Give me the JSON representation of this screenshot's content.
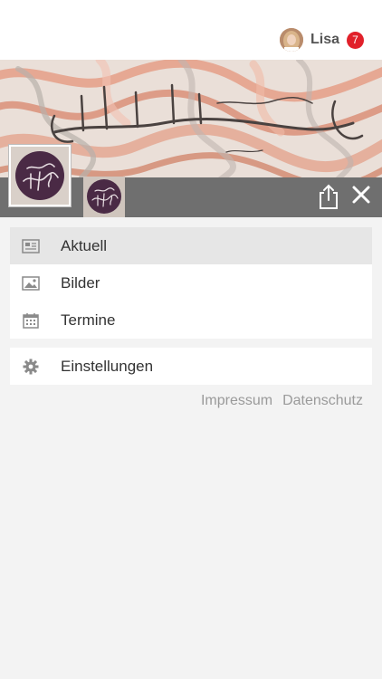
{
  "header": {
    "user_name": "Lisa",
    "notification_count": "7",
    "badge_color": "#e1202a",
    "avatar_icon": "user-avatar"
  },
  "banner": {
    "background_icon": "marbled-calligraphy-banner",
    "logo_large_icon": "calligraphy-logo",
    "logo_small_icon": "calligraphy-logo"
  },
  "toolbar": {
    "share_icon": "share-icon",
    "close_icon": "close-icon",
    "bar_color": "#6f6f6f"
  },
  "menu": {
    "items": [
      {
        "label": "Aktuell",
        "icon": "newspaper-icon",
        "active": true
      },
      {
        "label": "Bilder",
        "icon": "image-icon",
        "active": false
      },
      {
        "label": "Termine",
        "icon": "calendar-icon",
        "active": false
      }
    ]
  },
  "settings": {
    "label": "Einstellungen",
    "icon": "gear-icon"
  },
  "footer": {
    "impressum": "Impressum",
    "datenschutz": "Datenschutz"
  }
}
